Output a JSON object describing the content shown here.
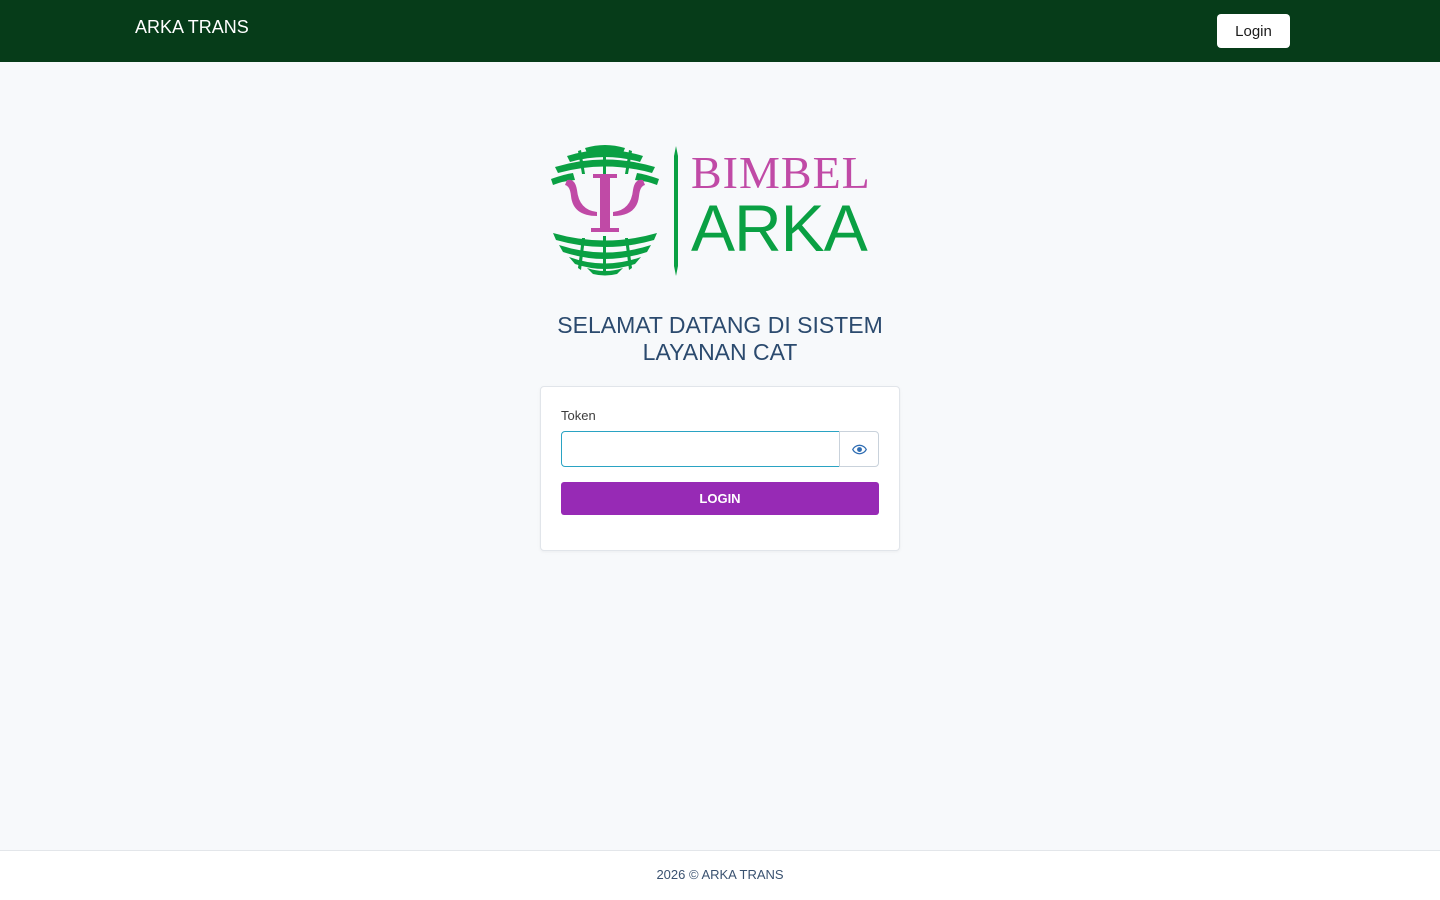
{
  "header": {
    "brand": "ARKA TRANS",
    "login_label": "Login"
  },
  "logo": {
    "line1": "BIMBEL",
    "line2": "ARKA",
    "symbol": "Ψ",
    "icon": "psi-globe-logo",
    "colors": {
      "green": "#0aa043",
      "magenta": "#c04aa6"
    }
  },
  "welcome": {
    "line1": "SELAMAT DATANG DI SISTEM",
    "line2": "LAYANAN CAT"
  },
  "form": {
    "token_label": "Token",
    "token_value": "",
    "token_placeholder": "",
    "toggle_icon": "eye-icon",
    "submit_label": "LOGIN"
  },
  "footer": {
    "text": "2026 © ARKA TRANS"
  },
  "colors": {
    "header_bg": "#063c19",
    "page_bg": "#f7f9fb",
    "button_purple": "#972ab5",
    "input_focus_border": "#2aa3c3",
    "text_dark_blue": "#2b4a6e"
  }
}
